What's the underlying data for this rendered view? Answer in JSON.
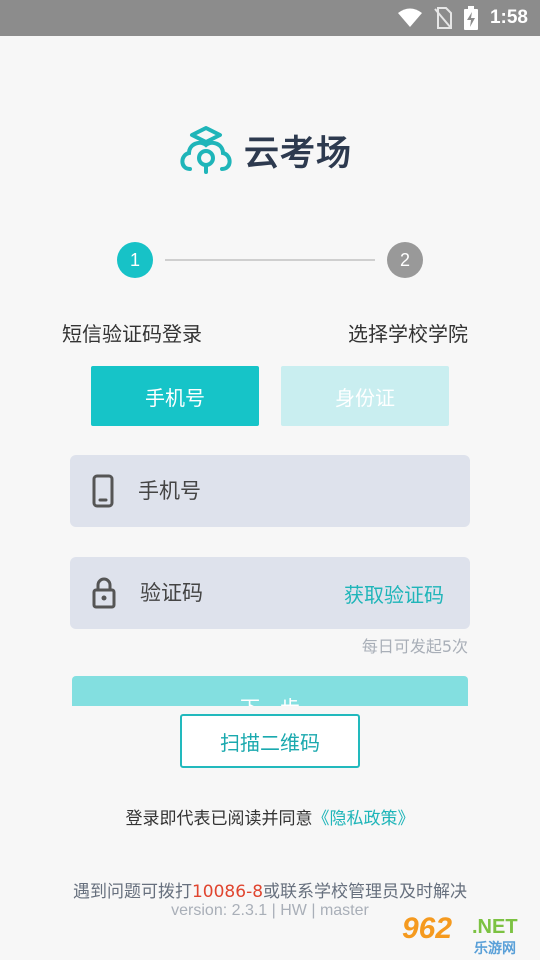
{
  "status_bar": {
    "time": "1:58"
  },
  "app": {
    "name": "云考场"
  },
  "stepper": {
    "step1_number": "1",
    "step2_number": "2",
    "step1_label": "短信验证码登录",
    "step2_label": "选择学校学院"
  },
  "tabs": {
    "phone": "手机号",
    "id_card": "身份证"
  },
  "form": {
    "phone_placeholder": "手机号",
    "code_placeholder": "验证码",
    "get_code_label": "获取验证码",
    "daily_limit_hint": "每日可发起5次",
    "next_label": "下一步"
  },
  "scan_button": "扫描二维码",
  "agreement": {
    "prefix": "登录即代表已阅读并同意",
    "link": "《隐私政策》"
  },
  "help": {
    "prefix": "遇到问题可拨打",
    "phone": "10086-8",
    "suffix": "或联系学校管理员及时解决"
  },
  "version": "version: 2.3.1 | HW | master",
  "watermark": {
    "number": "962",
    "net": ".NET",
    "site": "乐游网"
  },
  "colors": {
    "accent": "#16c4c8",
    "link": "#1fb5b9",
    "phone_highlight": "#e0452f"
  }
}
